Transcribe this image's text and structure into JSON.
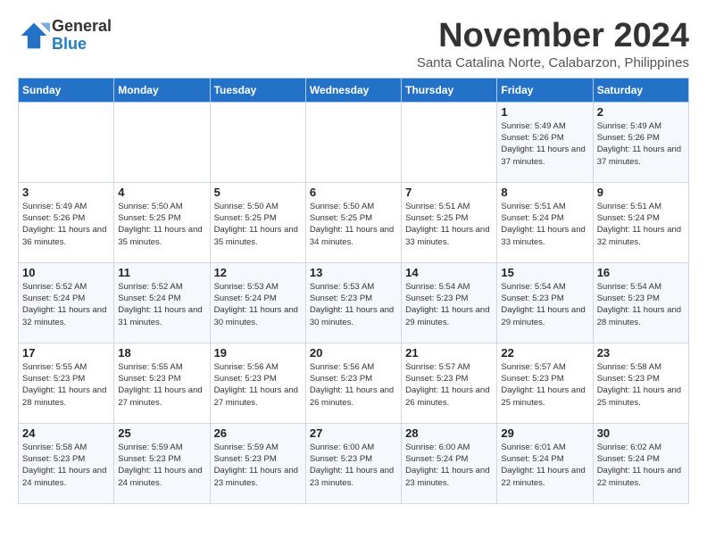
{
  "logo": {
    "general": "General",
    "blue": "Blue"
  },
  "title": "November 2024",
  "subtitle": "Santa Catalina Norte, Calabarzon, Philippines",
  "days_header": [
    "Sunday",
    "Monday",
    "Tuesday",
    "Wednesday",
    "Thursday",
    "Friday",
    "Saturday"
  ],
  "weeks": [
    [
      {
        "day": "",
        "info": ""
      },
      {
        "day": "",
        "info": ""
      },
      {
        "day": "",
        "info": ""
      },
      {
        "day": "",
        "info": ""
      },
      {
        "day": "",
        "info": ""
      },
      {
        "day": "1",
        "info": "Sunrise: 5:49 AM\nSunset: 5:26 PM\nDaylight: 11 hours and 37 minutes."
      },
      {
        "day": "2",
        "info": "Sunrise: 5:49 AM\nSunset: 5:26 PM\nDaylight: 11 hours and 37 minutes."
      }
    ],
    [
      {
        "day": "3",
        "info": "Sunrise: 5:49 AM\nSunset: 5:26 PM\nDaylight: 11 hours and 36 minutes."
      },
      {
        "day": "4",
        "info": "Sunrise: 5:50 AM\nSunset: 5:25 PM\nDaylight: 11 hours and 35 minutes."
      },
      {
        "day": "5",
        "info": "Sunrise: 5:50 AM\nSunset: 5:25 PM\nDaylight: 11 hours and 35 minutes."
      },
      {
        "day": "6",
        "info": "Sunrise: 5:50 AM\nSunset: 5:25 PM\nDaylight: 11 hours and 34 minutes."
      },
      {
        "day": "7",
        "info": "Sunrise: 5:51 AM\nSunset: 5:25 PM\nDaylight: 11 hours and 33 minutes."
      },
      {
        "day": "8",
        "info": "Sunrise: 5:51 AM\nSunset: 5:24 PM\nDaylight: 11 hours and 33 minutes."
      },
      {
        "day": "9",
        "info": "Sunrise: 5:51 AM\nSunset: 5:24 PM\nDaylight: 11 hours and 32 minutes."
      }
    ],
    [
      {
        "day": "10",
        "info": "Sunrise: 5:52 AM\nSunset: 5:24 PM\nDaylight: 11 hours and 32 minutes."
      },
      {
        "day": "11",
        "info": "Sunrise: 5:52 AM\nSunset: 5:24 PM\nDaylight: 11 hours and 31 minutes."
      },
      {
        "day": "12",
        "info": "Sunrise: 5:53 AM\nSunset: 5:24 PM\nDaylight: 11 hours and 30 minutes."
      },
      {
        "day": "13",
        "info": "Sunrise: 5:53 AM\nSunset: 5:23 PM\nDaylight: 11 hours and 30 minutes."
      },
      {
        "day": "14",
        "info": "Sunrise: 5:54 AM\nSunset: 5:23 PM\nDaylight: 11 hours and 29 minutes."
      },
      {
        "day": "15",
        "info": "Sunrise: 5:54 AM\nSunset: 5:23 PM\nDaylight: 11 hours and 29 minutes."
      },
      {
        "day": "16",
        "info": "Sunrise: 5:54 AM\nSunset: 5:23 PM\nDaylight: 11 hours and 28 minutes."
      }
    ],
    [
      {
        "day": "17",
        "info": "Sunrise: 5:55 AM\nSunset: 5:23 PM\nDaylight: 11 hours and 28 minutes."
      },
      {
        "day": "18",
        "info": "Sunrise: 5:55 AM\nSunset: 5:23 PM\nDaylight: 11 hours and 27 minutes."
      },
      {
        "day": "19",
        "info": "Sunrise: 5:56 AM\nSunset: 5:23 PM\nDaylight: 11 hours and 27 minutes."
      },
      {
        "day": "20",
        "info": "Sunrise: 5:56 AM\nSunset: 5:23 PM\nDaylight: 11 hours and 26 minutes."
      },
      {
        "day": "21",
        "info": "Sunrise: 5:57 AM\nSunset: 5:23 PM\nDaylight: 11 hours and 26 minutes."
      },
      {
        "day": "22",
        "info": "Sunrise: 5:57 AM\nSunset: 5:23 PM\nDaylight: 11 hours and 25 minutes."
      },
      {
        "day": "23",
        "info": "Sunrise: 5:58 AM\nSunset: 5:23 PM\nDaylight: 11 hours and 25 minutes."
      }
    ],
    [
      {
        "day": "24",
        "info": "Sunrise: 5:58 AM\nSunset: 5:23 PM\nDaylight: 11 hours and 24 minutes."
      },
      {
        "day": "25",
        "info": "Sunrise: 5:59 AM\nSunset: 5:23 PM\nDaylight: 11 hours and 24 minutes."
      },
      {
        "day": "26",
        "info": "Sunrise: 5:59 AM\nSunset: 5:23 PM\nDaylight: 11 hours and 23 minutes."
      },
      {
        "day": "27",
        "info": "Sunrise: 6:00 AM\nSunset: 5:23 PM\nDaylight: 11 hours and 23 minutes."
      },
      {
        "day": "28",
        "info": "Sunrise: 6:00 AM\nSunset: 5:24 PM\nDaylight: 11 hours and 23 minutes."
      },
      {
        "day": "29",
        "info": "Sunrise: 6:01 AM\nSunset: 5:24 PM\nDaylight: 11 hours and 22 minutes."
      },
      {
        "day": "30",
        "info": "Sunrise: 6:02 AM\nSunset: 5:24 PM\nDaylight: 11 hours and 22 minutes."
      }
    ]
  ]
}
